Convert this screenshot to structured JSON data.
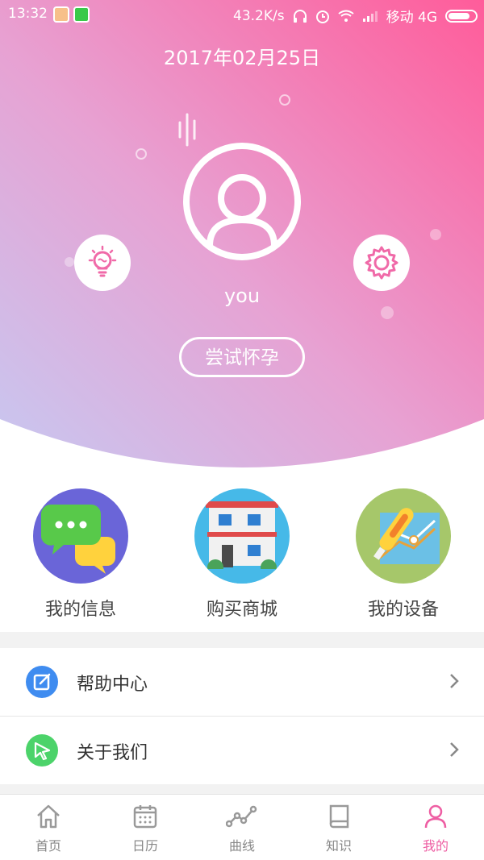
{
  "status_bar": {
    "time": "13:32",
    "net_speed": "43.2K/s",
    "carrier": "移动 4G"
  },
  "header": {
    "date": "2017年02月25日",
    "username": "you",
    "try_button": "尝试怀孕",
    "left_icon": "lightbulb-icon",
    "right_icon": "gear-icon",
    "gradient_colors": [
      "#ff5c9a",
      "#e9a6d6",
      "#c9c4f0"
    ]
  },
  "shortcuts": [
    {
      "label": "我的信息",
      "icon": "chat-bubbles-icon",
      "color": "#6a65d8"
    },
    {
      "label": "购买商城",
      "icon": "store-building-icon",
      "color": "#46b9e8"
    },
    {
      "label": "我的设备",
      "icon": "thermometer-chart-icon",
      "color": "#a6c76a"
    }
  ],
  "menu": [
    {
      "label": "帮助中心",
      "icon": "edit-icon",
      "color": "#3f8cf0"
    },
    {
      "label": "关于我们",
      "icon": "cursor-icon",
      "color": "#4cd36a"
    }
  ],
  "tabs": [
    {
      "label": "首页",
      "icon": "home-icon"
    },
    {
      "label": "日历",
      "icon": "calendar-icon"
    },
    {
      "label": "曲线",
      "icon": "curve-icon"
    },
    {
      "label": "知识",
      "icon": "book-icon"
    },
    {
      "label": "我的",
      "icon": "person-icon",
      "active": true
    }
  ],
  "accent_color": "#ee5ea3"
}
